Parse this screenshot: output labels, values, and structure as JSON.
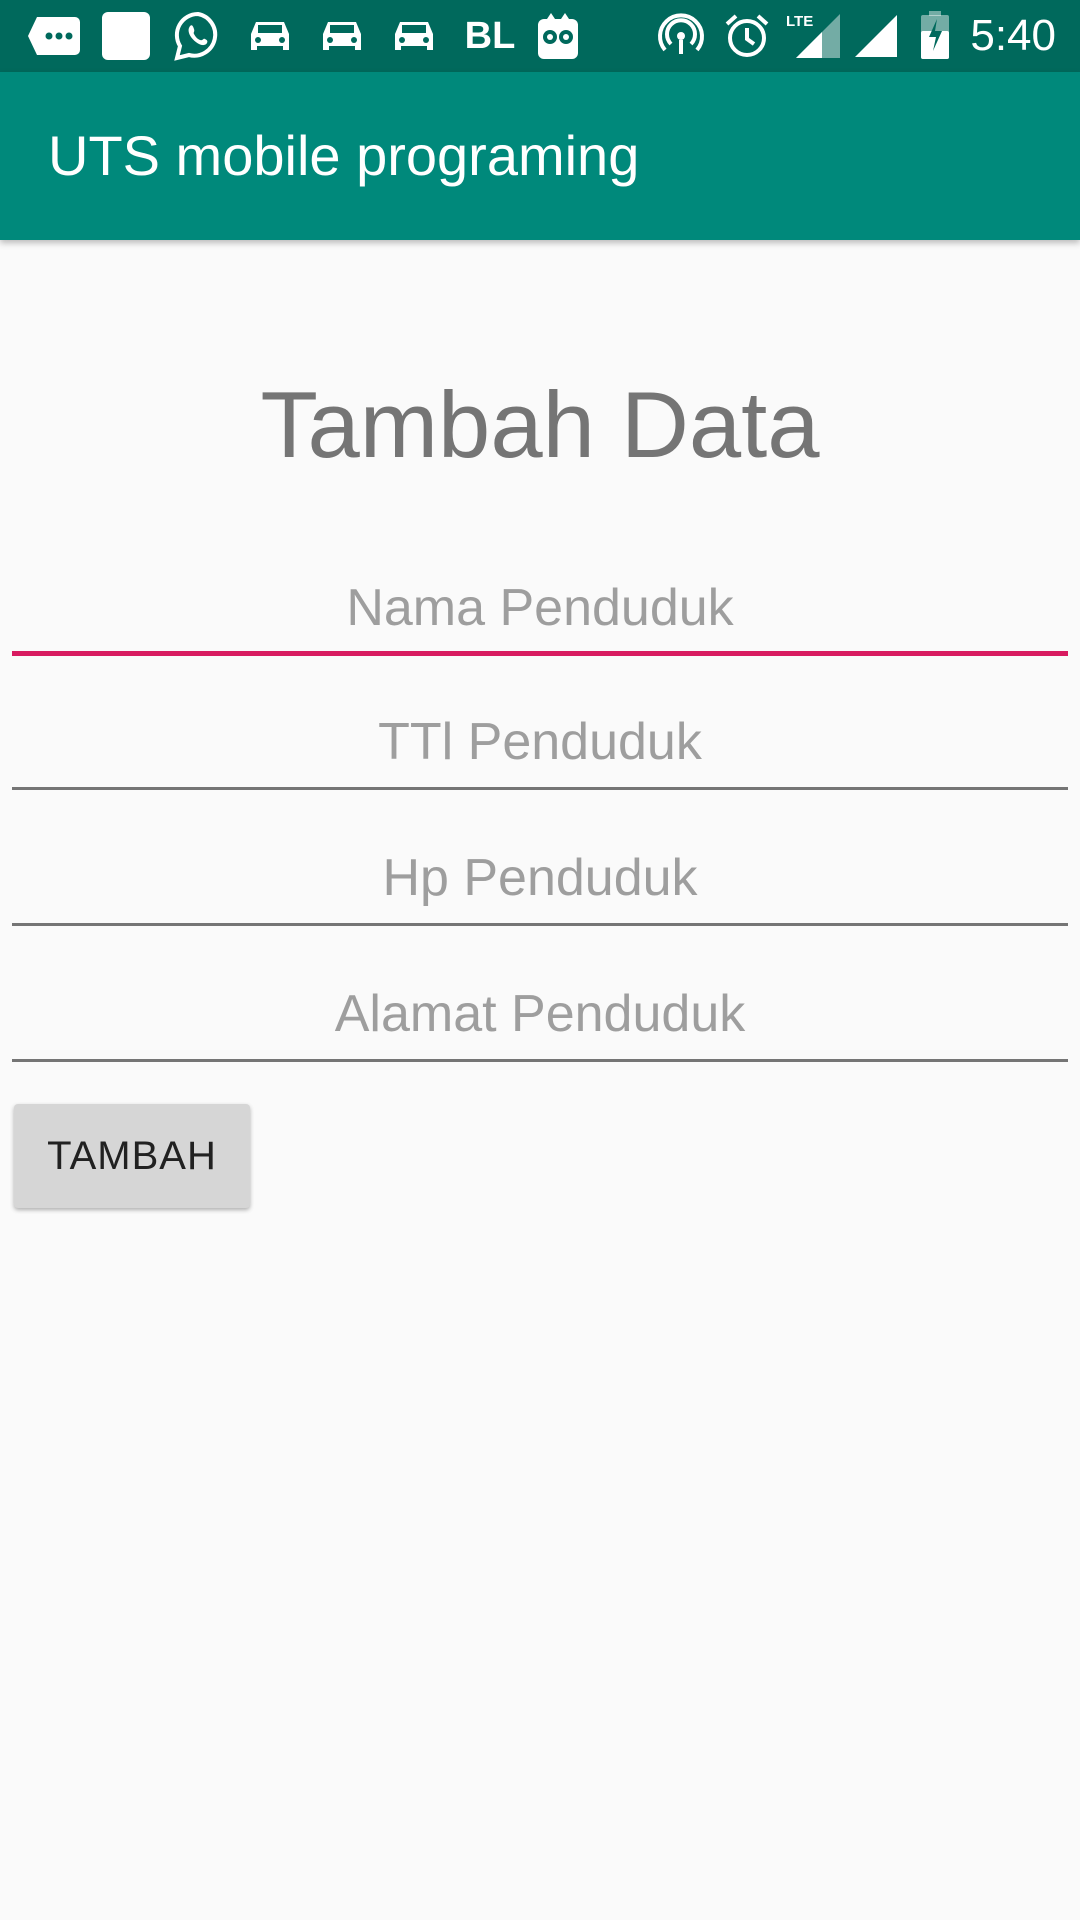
{
  "status_bar": {
    "time": "5:40",
    "bl_label": "BL",
    "lte_label": "LTE",
    "left_icons": [
      "message-dots-icon",
      "blank-square-icon",
      "whatsapp-icon",
      "car-icon",
      "car-icon",
      "car-icon",
      "bl-icon",
      "owl-icon"
    ],
    "right_icons": [
      "hotspot-icon",
      "alarm-icon",
      "lte-signal-icon",
      "signal-icon",
      "battery-icon"
    ]
  },
  "app_bar": {
    "title": "UTS mobile programing"
  },
  "form": {
    "heading": "Tambah Data",
    "fields": [
      {
        "placeholder": "Nama Penduduk",
        "value": ""
      },
      {
        "placeholder": "TTl Penduduk",
        "value": ""
      },
      {
        "placeholder": "Hp Penduduk",
        "value": ""
      },
      {
        "placeholder": "Alamat Penduduk",
        "value": ""
      }
    ],
    "submit_label": "TAMBAH"
  },
  "colors": {
    "status_bar": "#00695c",
    "app_bar": "#00897b",
    "accent": "#d81b60",
    "background": "#fafafa"
  }
}
